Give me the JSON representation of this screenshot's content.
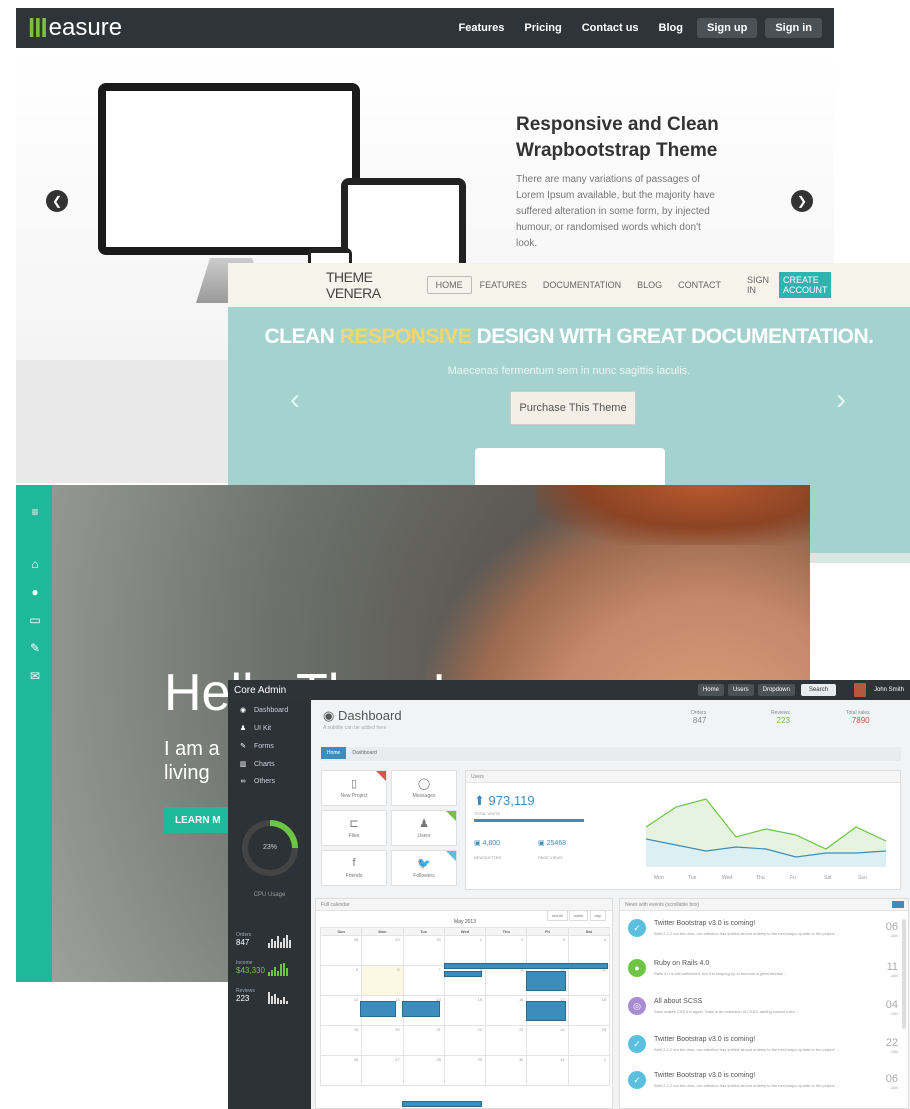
{
  "measure": {
    "logo_text": "easure",
    "nav": [
      "Features",
      "Pricing",
      "Contact us",
      "Blog"
    ],
    "signup": "Sign up",
    "signin": "Sign in",
    "hero_title": "Responsive and Clean Wrapbootstrap Theme",
    "hero_text": "There are many variations of passages of Lorem Ipsum available, but the majority have suffered alteration in some form, by injected humour, or randomised words which don't look."
  },
  "venera": {
    "brand": "THEME VENERA",
    "nav": [
      "HOME",
      "FEATURES",
      "DOCUMENTATION",
      "BLOG",
      "CONTACT"
    ],
    "signin": "SIGN IN",
    "create": "CREATE ACCOUNT",
    "headline_pre": "CLEAN ",
    "headline_hl": "RESPONSIVE",
    "headline_post": " DESIGN WITH GREAT DOCUMENTATION.",
    "sub": "Maecenas fermentum sem in nunc sagittis iaculis.",
    "button": "Purchase This Theme"
  },
  "hello": {
    "headline": "Hello There!",
    "tagline_1": "I am a",
    "tagline_2": "living",
    "learn": "LEARN M"
  },
  "admin": {
    "brand": "Core Admin",
    "topbar": [
      "Home",
      "Users",
      "Dropdown",
      "Search"
    ],
    "user": "John Smith",
    "sidebar": [
      "Dashboard",
      "UI Kit",
      "Forms",
      "Charts",
      "Others"
    ],
    "cpu_value": "23%",
    "cpu_label": "CPU Usage",
    "side_stats": [
      {
        "label": "Orders",
        "value": "847"
      },
      {
        "label": "Income",
        "value": "$43,330"
      },
      {
        "label": "Reviews",
        "value": "223"
      }
    ],
    "title": "Dashboard",
    "subtitle": "A subtitle can be added here",
    "stats": [
      {
        "label": "Orders",
        "value": "847"
      },
      {
        "label": "Reviews",
        "value": "223"
      },
      {
        "label": "Total sales",
        "value": "7890"
      }
    ],
    "breadcrumb": [
      "Home",
      "Dashboard"
    ],
    "tiles": [
      "New Project",
      "Messages",
      "Files",
      "Users",
      "Friends",
      "Followers"
    ],
    "users_panel": "Users",
    "total_visits": "973,119",
    "total_visits_label": "TOTAL VISITS",
    "newsletter": "4,800",
    "newsletter_label": "NEWSLETTER",
    "page_views": "25468",
    "page_views_label": "PAGE VIEWS",
    "chart_days": [
      "Mon",
      "Tue",
      "Wed",
      "Thu",
      "Fri",
      "Sat",
      "Sun"
    ],
    "calendar_title": "Full calendar",
    "calendar_month": "May 2013",
    "calendar_views": [
      "month",
      "week",
      "day"
    ],
    "weekdays": [
      "Sun",
      "Mon",
      "Tue",
      "Wed",
      "Thu",
      "Fri",
      "Sat"
    ],
    "news_title": "News with events (scrollable box)",
    "news": [
      {
        "title": "Twitter Bootstrap v3.0 is coming!",
        "text": "With 2.2.2 out the door, our attention has shifted almost entirely to the next major update to the project ...",
        "day": "06",
        "month": "JAN"
      },
      {
        "title": "Ruby on Rails 4.0",
        "text": "Rails 4.0 is still unfinished, but it is shaping up to become a great release ...",
        "day": "11",
        "month": "JAN"
      },
      {
        "title": "All about SCSS",
        "text": "Sass makes CSS fun again. Sass is an extension of CSS3, adding nested rules ...",
        "day": "04",
        "month": "JAN"
      },
      {
        "title": "Twitter Bootstrap v3.0 is coming!",
        "text": "With 2.2.2 out the door, our attention has shifted almost entirely to the next major update to the project ...",
        "day": "22",
        "month": "JAN"
      },
      {
        "title": "Twitter Bootstrap v3.0 is coming!",
        "text": "With 2.2.2 out the door, our attention has shifted almost entirely to the next major update to the project ...",
        "day": "06",
        "month": "JAN"
      }
    ]
  }
}
